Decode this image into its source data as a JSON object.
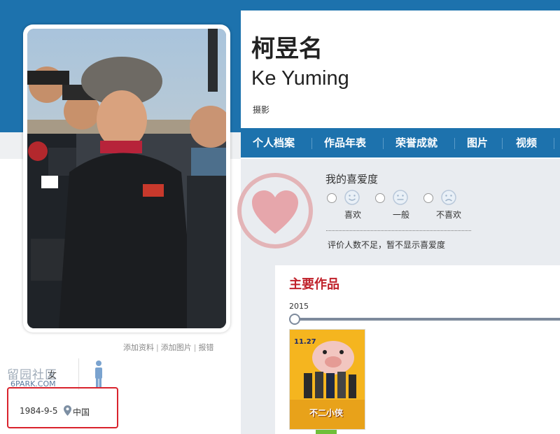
{
  "profile": {
    "name_cn": "柯昱名",
    "name_en": "Ke Yuming",
    "role": "摄影",
    "gender": "女",
    "birth_date": "1984-9-5",
    "region": "中国"
  },
  "photo_links": [
    "添加资料",
    "添加图片",
    "报错"
  ],
  "watermark": {
    "text": "留园社区",
    "sub": "6PARK.COM"
  },
  "nav": {
    "items": [
      "个人档案",
      "作品年表",
      "荣誉成就",
      "图片",
      "视频"
    ]
  },
  "rating": {
    "title": "我的喜爱度",
    "options": [
      "喜欢",
      "一般",
      "不喜欢"
    ],
    "note": "评价人数不足，暂不显示喜爱度"
  },
  "works": {
    "title": "主要作品",
    "year": "2015",
    "poster_date": "11.27",
    "poster_title": "不二小侠"
  },
  "colors": {
    "brand_blue": "#1d72ad",
    "accent_red": "#c0222b",
    "highlight_box": "#d9232d"
  },
  "icons": [
    "location-pin-icon",
    "person-icon",
    "heart-icon",
    "smile-face-icon",
    "neutral-face-icon",
    "sad-face-icon"
  ]
}
